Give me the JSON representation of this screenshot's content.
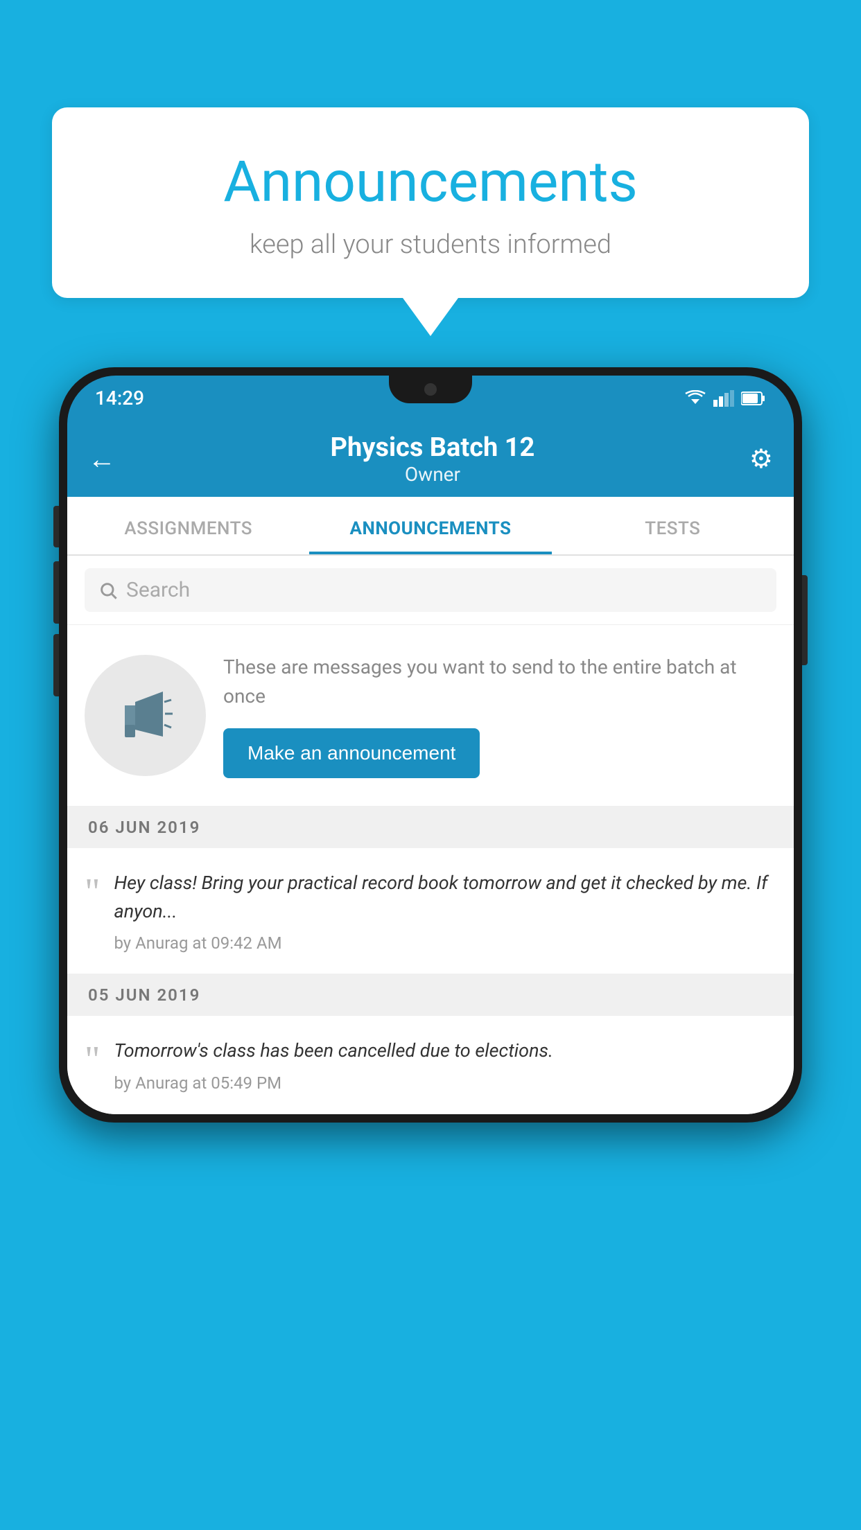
{
  "background_color": "#18b0e0",
  "speech_bubble": {
    "title": "Announcements",
    "subtitle": "keep all your students informed"
  },
  "phone": {
    "status_bar": {
      "time": "14:29"
    },
    "app_bar": {
      "title": "Physics Batch 12",
      "subtitle": "Owner",
      "back_label": "←",
      "settings_label": "⚙"
    },
    "tabs": [
      {
        "label": "ASSIGNMENTS",
        "active": false
      },
      {
        "label": "ANNOUNCEMENTS",
        "active": true
      },
      {
        "label": "TESTS",
        "active": false
      }
    ],
    "search": {
      "placeholder": "Search"
    },
    "promo": {
      "description": "These are messages you want to send to the entire batch at once",
      "button_label": "Make an announcement"
    },
    "announcements": [
      {
        "date": "06  JUN  2019",
        "items": [
          {
            "text": "Hey class! Bring your practical record book tomorrow and get it checked by me. If anyon...",
            "meta": "by Anurag at 09:42 AM"
          }
        ]
      },
      {
        "date": "05  JUN  2019",
        "items": [
          {
            "text": "Tomorrow's class has been cancelled due to elections.",
            "meta": "by Anurag at 05:49 PM"
          }
        ]
      }
    ]
  }
}
